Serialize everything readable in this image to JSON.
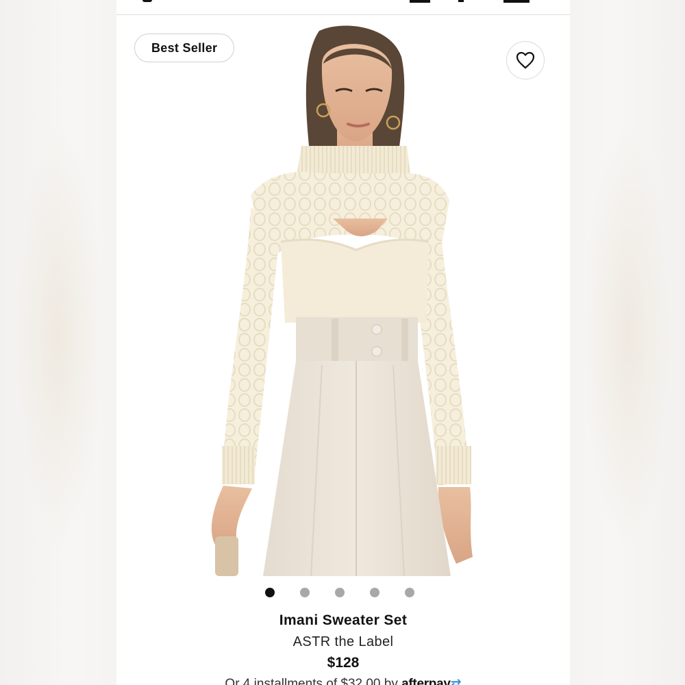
{
  "badge": {
    "label": "Best Seller"
  },
  "favorite": {
    "icon": "heart-outline-icon"
  },
  "gallery": {
    "total_images": 5,
    "active_index": 0
  },
  "product": {
    "name": "Imani Sweater Set",
    "brand": "ASTR the Label",
    "price": "$128",
    "installments_text": "Or 4 installments of $32.00 by",
    "installments_provider": "afterpay"
  },
  "colors": {
    "sweater": "#f6efdc",
    "pants": "#e9e1d6",
    "skin": "#e2b394",
    "hair": "#5a4636",
    "afterpay_mark": "#3a8fd9"
  }
}
